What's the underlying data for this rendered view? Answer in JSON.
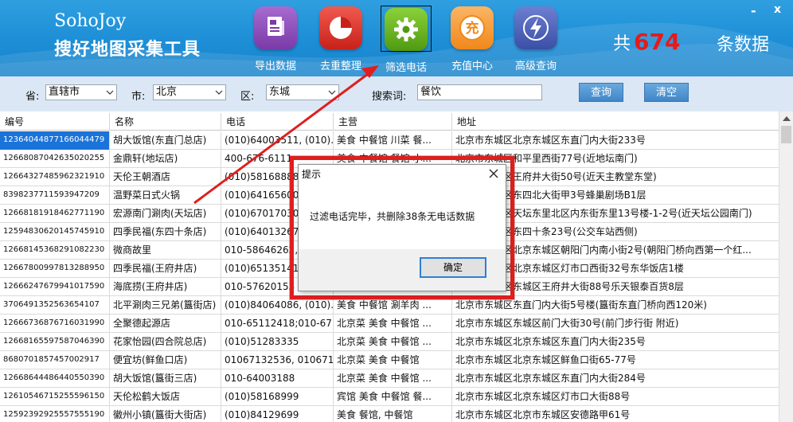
{
  "header": {
    "brand_en": "SohoJoy",
    "brand_cn": "搜好地图采集工具",
    "tools": [
      {
        "label": "导出数据",
        "icon": "export-document-icon"
      },
      {
        "label": "去重整理",
        "icon": "pie-chart-icon"
      },
      {
        "label": "筛选电话",
        "icon": "gear-icon"
      },
      {
        "label": "充值中心",
        "icon": "recharge-coin-icon"
      },
      {
        "label": "高级查询",
        "icon": "lightning-icon"
      }
    ],
    "total_prefix": "共",
    "total_count": "674",
    "total_suffix": "条数据",
    "minimize": "-",
    "close": "x"
  },
  "filters": {
    "province_label": "省:",
    "province_value": "直辖市",
    "city_label": "市:",
    "city_value": "北京",
    "district_label": "区:",
    "district_value": "东城",
    "keyword_label": "搜索词:",
    "keyword_value": "餐饮",
    "query_button": "查询",
    "clear_button": "清空"
  },
  "table": {
    "columns": [
      "编号",
      "名称",
      "电话",
      "主营",
      "地址"
    ],
    "rows": [
      [
        "12364044877166044479",
        "胡大饭馆(东直门总店)",
        "(010)64003511, (010)...",
        "美食 中餐馆 川菜 餐...",
        "北京市东城区北京东城区东直门内大街233号"
      ],
      [
        "12668087042635020255",
        "金鼎轩(地坛店)",
        "400-676-6111",
        "美食 中餐馆 餐馆 小...",
        "北京市东城区和平里西街77号(近地坛南门)"
      ],
      [
        "12664327485962321910",
        "天伦王朝酒店",
        "(010)58168888",
        "",
        "北京市东城区王府井大街50号(近天主教堂东堂)"
      ],
      [
        "8398237711593947209",
        "温野菜日式火锅",
        "(010)64165600",
        "",
        "北京市东城区东四北大街甲3号蜂巢剧场B1层"
      ],
      [
        "12668181918462771190",
        "宏源南门涮肉(天坛店)",
        "(010)67017030",
        "",
        "北京市东城区天坛东里北区内东街东里13号楼-1-2号(近天坛公园南门)"
      ],
      [
        "12594830620145745910",
        "四季民福(东四十条店)",
        "(010)64013267",
        "",
        "北京市东城区东四十条23号(公交车站西侧)"
      ],
      [
        "12668145368291082230",
        "微商故里",
        "010-58646262, (010)...",
        "",
        "北京市东城区北京东城区朝阳门内南小街2号(朝阳门桥向西第一个红..."
      ],
      [
        "12667800997813288950",
        "四季民福(王府井店)",
        "(010)65135141",
        "",
        "北京市东城区北京东城区灯市口西街32号东华饭店1楼"
      ],
      [
        "12666247679941017590",
        "海底捞(王府井店)",
        "010-57620153",
        "",
        "北京市东城区东城区王府井大街88号乐天银泰百货8层"
      ],
      [
        "3706491352563654107",
        "北平涮肉三兄弟(簋街店)",
        "(010)84064086, (010)...",
        "美食 中餐馆 涮羊肉 ...",
        "北京市东城区东直门内大街5号楼(簋街东直门桥向西120米)"
      ],
      [
        "12666736876716031990",
        "全聚德起源店",
        "010-65112418;010-67...",
        "北京菜 美食 中餐馆 ...",
        "北京市东城区东城区前门大街30号(前门步行街 附近)"
      ],
      [
        "12668165597587046390",
        "花家怡园(四合院总店)",
        "(010)51283335",
        "北京菜 美食 中餐馆 ...",
        "北京市东城区北京东城区东直门内大街235号"
      ],
      [
        "8680701857457002917",
        "便宜坊(鲜鱼口店)",
        "01067132536, 0106713...",
        "北京菜 美食 中餐馆",
        "北京市东城区北京东城区鲜鱼口街65-77号"
      ],
      [
        "12668644486440550390",
        "胡大饭馆(簋街三店)",
        "010-64003188",
        "北京菜 美食 中餐馆 ...",
        "北京市东城区北京东城区东直门内大街284号"
      ],
      [
        "12610546715255596150",
        "天伦松鹤大饭店",
        "(010)58168999",
        "宾馆 美食 中餐馆 餐...",
        "北京市东城区北京东城区灯市口大街88号"
      ],
      [
        "12592392925557555190",
        "徽州小镇(簋街大街店)",
        "(010)84129699",
        "美食 餐馆, 中餐馆",
        "北京市东城区北京市东城区安德路甲61号"
      ]
    ]
  },
  "dialog": {
    "title": "提示",
    "message": "过滤电话完毕，共删除38条无电话数据",
    "ok_button": "确定"
  },
  "colors": {
    "header_blue": "#1d8ed6",
    "total_red": "#e51b1b",
    "annotation_red": "#e01e1e",
    "selection_blue": "#1a73d9"
  }
}
